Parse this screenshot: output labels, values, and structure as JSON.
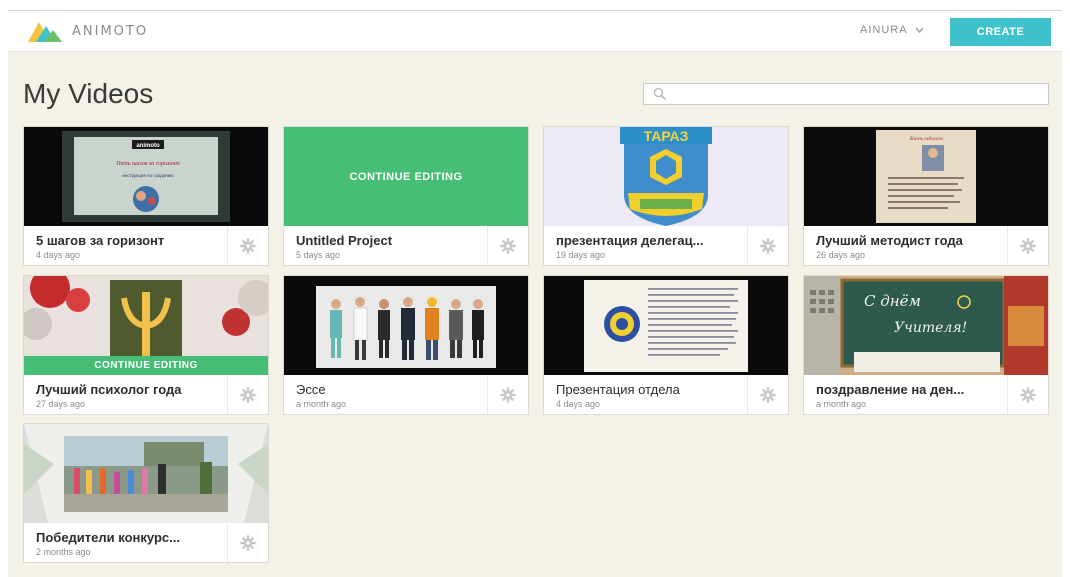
{
  "header": {
    "logo_text": "ANIMOTO",
    "user_name": "AINURA",
    "create_label": "CREATE"
  },
  "main": {
    "title": "My Videos",
    "search": {
      "placeholder": "",
      "value": ""
    }
  },
  "videos": [
    {
      "title": "5 шагов за горизонт",
      "date": "4 days ago"
    },
    {
      "title": "Untitled Project",
      "date": "5 days ago",
      "overlay": "CONTINUE EDITING"
    },
    {
      "title": "презентация делегац...",
      "date": "19 days ago"
    },
    {
      "title": "Лучший методист года",
      "date": "26 days ago"
    },
    {
      "title": "Лучший психолог года",
      "date": "27 days ago",
      "overlay": "CONTINUE EDITING"
    },
    {
      "title": "Эссе",
      "date": "a month ago"
    },
    {
      "title": "Презентация отдела",
      "date": "4 days ago"
    },
    {
      "title": "поздравление на ден...",
      "date": "a month ago"
    },
    {
      "title": "Победители конкурс...",
      "date": "2 months ago"
    }
  ],
  "thumbnail_text": {
    "video_1": {
      "badge": "animoto",
      "headline": "Пять шагов за горизонт",
      "subline": "инструкция по созданию"
    },
    "video_3": {
      "banner": "ТАРАЗ"
    },
    "video_4": {
      "heading": "Жизнь педагога"
    },
    "video_8": {
      "line1": "С днём",
      "line2": "Учителя!"
    }
  },
  "icons": {
    "logo": "animoto-logo-icon",
    "user_menu": "chevron-down-icon",
    "search": "search-icon",
    "card_settings": "gear-icon"
  },
  "colors": {
    "accent_create": "#3ec3cd",
    "continue_editing": "#47be76",
    "page_background": "#f4f1e8"
  }
}
